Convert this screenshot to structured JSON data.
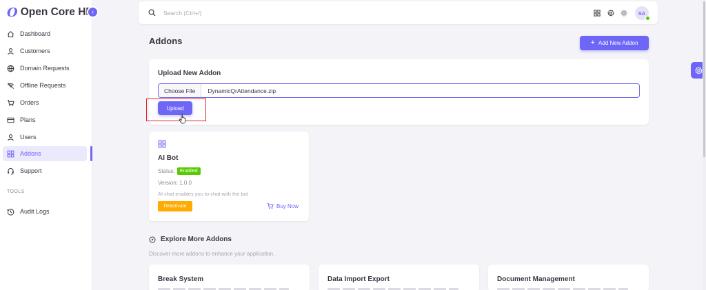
{
  "brand": {
    "logo": "O",
    "name": "Open Core HR"
  },
  "sidebar": {
    "items": [
      {
        "label": "Dashboard",
        "icon": "home-icon"
      },
      {
        "label": "Customers",
        "icon": "user-icon"
      },
      {
        "label": "Domain Requests",
        "icon": "globe-icon"
      },
      {
        "label": "Offline Requests",
        "icon": "wifi-off-icon"
      },
      {
        "label": "Orders",
        "icon": "cart-icon"
      },
      {
        "label": "Plans",
        "icon": "credit-card-icon"
      },
      {
        "label": "Users",
        "icon": "user-icon"
      },
      {
        "label": "Addons",
        "icon": "apps-icon"
      },
      {
        "label": "Support",
        "icon": "headset-icon"
      }
    ],
    "section_label": "TOOLS",
    "tools": [
      {
        "label": "Audit Logs",
        "icon": "history-icon"
      }
    ]
  },
  "topbar": {
    "search_placeholder": "Search (Ctrl+/)",
    "avatar_initials": "SA"
  },
  "page": {
    "title": "Addons",
    "add_button": "Add New Addon"
  },
  "upload": {
    "title": "Upload New Addon",
    "choose_file": "Choose File",
    "file_name": "DynamicQrAttendance.zip",
    "upload_button": "Upload"
  },
  "addon": {
    "name": "AI Bot",
    "status_label": "Status:",
    "status": "Enabled",
    "version": "Version: 1.0.0",
    "description": "AI chat enables you to chat with the bot",
    "deactivate": "Deactivate",
    "buy_now": "Buy Now"
  },
  "explore": {
    "title": "Explore More Addons",
    "subtitle": "Discover more addons to enhance your application.",
    "cards": [
      "Break System",
      "Data Import Export",
      "Document Management"
    ]
  },
  "colors": {
    "primary": "#6d66f6",
    "success": "#56ca00",
    "warning": "#ffab00",
    "highlight": "#e0242a"
  }
}
